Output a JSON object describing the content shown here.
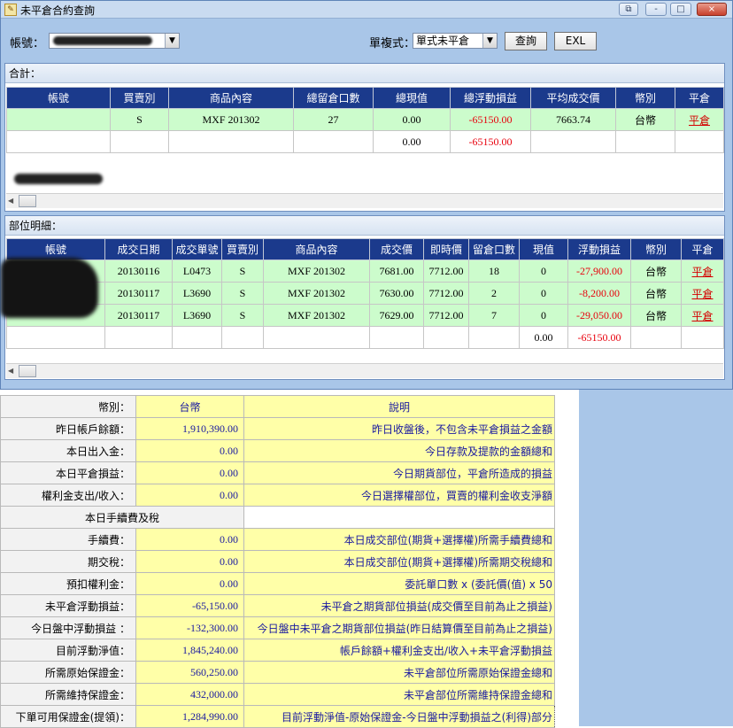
{
  "window": {
    "title": "未平倉合約查詢",
    "controls": [
      "-",
      "□",
      "×"
    ]
  },
  "toolbar": {
    "account_label": "帳號：",
    "account_value": "",
    "mode_label": "單複式：",
    "mode_value": "單式未平倉",
    "query_button": "查詢",
    "excel_button": "EXL"
  },
  "totals_panel": {
    "title": "合計：",
    "columns": [
      "帳號",
      "買賣別",
      "商品內容",
      "總留倉口數",
      "總現值",
      "總浮動損益",
      "平均成交價",
      "幣別",
      "平倉"
    ],
    "rows": [
      {
        "account": "",
        "side": "S",
        "product": "MXF 201302",
        "lots": "27",
        "value": "0.00",
        "pnl": "-65150.00",
        "avg_price": "7663.74",
        "currency": "台幣",
        "action": "平倉",
        "green": true
      },
      {
        "account": "",
        "side": "",
        "product": "",
        "lots": "",
        "value": "0.00",
        "pnl": "-65150.00",
        "avg_price": "",
        "currency": "",
        "action": "",
        "green": false
      }
    ]
  },
  "detail_panel": {
    "title": "部位明細：",
    "columns": [
      "帳號",
      "成交日期",
      "成交單號",
      "買賣別",
      "商品內容",
      "成交價",
      "即時價",
      "留倉口數",
      "現值",
      "浮動損益",
      "幣別",
      "平倉"
    ],
    "rows": [
      {
        "account": "",
        "date": "20130116",
        "order": "L0473",
        "side": "S",
        "product": "MXF 201302",
        "price": "7681.00",
        "last": "7712.00",
        "lots": "18",
        "value": "0",
        "pnl": "-27,900.00",
        "currency": "台幣",
        "action": "平倉",
        "green": true
      },
      {
        "account": "",
        "date": "20130117",
        "order": "L3690",
        "side": "S",
        "product": "MXF 201302",
        "price": "7630.00",
        "last": "7712.00",
        "lots": "2",
        "value": "0",
        "pnl": "-8,200.00",
        "currency": "台幣",
        "action": "平倉",
        "green": true
      },
      {
        "account": "",
        "date": "20130117",
        "order": "L3690",
        "side": "S",
        "product": "MXF 201302",
        "price": "7629.00",
        "last": "7712.00",
        "lots": "7",
        "value": "0",
        "pnl": "-29,050.00",
        "currency": "台幣",
        "action": "平倉",
        "green": true
      },
      {
        "account": "",
        "date": "",
        "order": "",
        "side": "",
        "product": "",
        "price": "",
        "last": "",
        "lots": "",
        "value": "0.00",
        "pnl": "-65150.00",
        "currency": "",
        "action": "",
        "green": false
      }
    ]
  },
  "summary": {
    "header": {
      "key": "幣別：",
      "currency": "台幣",
      "desc": "說明"
    },
    "rows": [
      {
        "key": "昨日帳戶餘額：",
        "value": "1,910,390.00",
        "desc": "昨日收盤後，不包含未平倉損益之金額"
      },
      {
        "key": "本日出入金：",
        "value": "0.00",
        "desc": "今日存款及提款的金額總和"
      },
      {
        "key": "本日平倉損益：",
        "value": "0.00",
        "desc": "今日期貨部位，平倉所造成的損益"
      },
      {
        "key": "權利金支出/收入：",
        "value": "0.00",
        "desc": "今日選擇權部位，買賣的權利金收支淨額"
      }
    ],
    "section": "本日手續費及稅",
    "rows2": [
      {
        "key": "手續費：",
        "value": "0.00",
        "desc": "本日成交部位(期貨+選擇權)所需手續費總和"
      },
      {
        "key": "期交稅：",
        "value": "0.00",
        "desc": "本日成交部位(期貨+選擇權)所需期交稅總和"
      },
      {
        "key": "預扣權利金：",
        "value": "0.00",
        "desc": "委託單口數 x (委託價(值) x 50"
      },
      {
        "key": "未平倉浮動損益：",
        "value": "-65,150.00",
        "desc": "未平倉之期貨部位損益(成交價至目前為止之損益)"
      },
      {
        "key": "今日盤中浮動損益 ：",
        "value": "-132,300.00",
        "desc": "今日盤中未平倉之期貨部位損益(昨日結算價至目前為止之損益)"
      },
      {
        "key": "目前浮動淨值：",
        "value": "1,845,240.00",
        "desc": "帳戶餘額+權利金支出/收入+未平倉浮動損益"
      },
      {
        "key": "所需原始保證金：",
        "value": "560,250.00",
        "desc": "未平倉部位所需原始保證金總和"
      },
      {
        "key": "所需維持保證金：",
        "value": "432,000.00",
        "desc": "未平倉部位所需維持保證金總和"
      },
      {
        "key": "下單可用保證金(提領)：",
        "value": "1,284,990.00",
        "desc": "目前浮動淨值-原始保證金-今日盤中浮動損益之(利得)部分"
      }
    ]
  }
}
